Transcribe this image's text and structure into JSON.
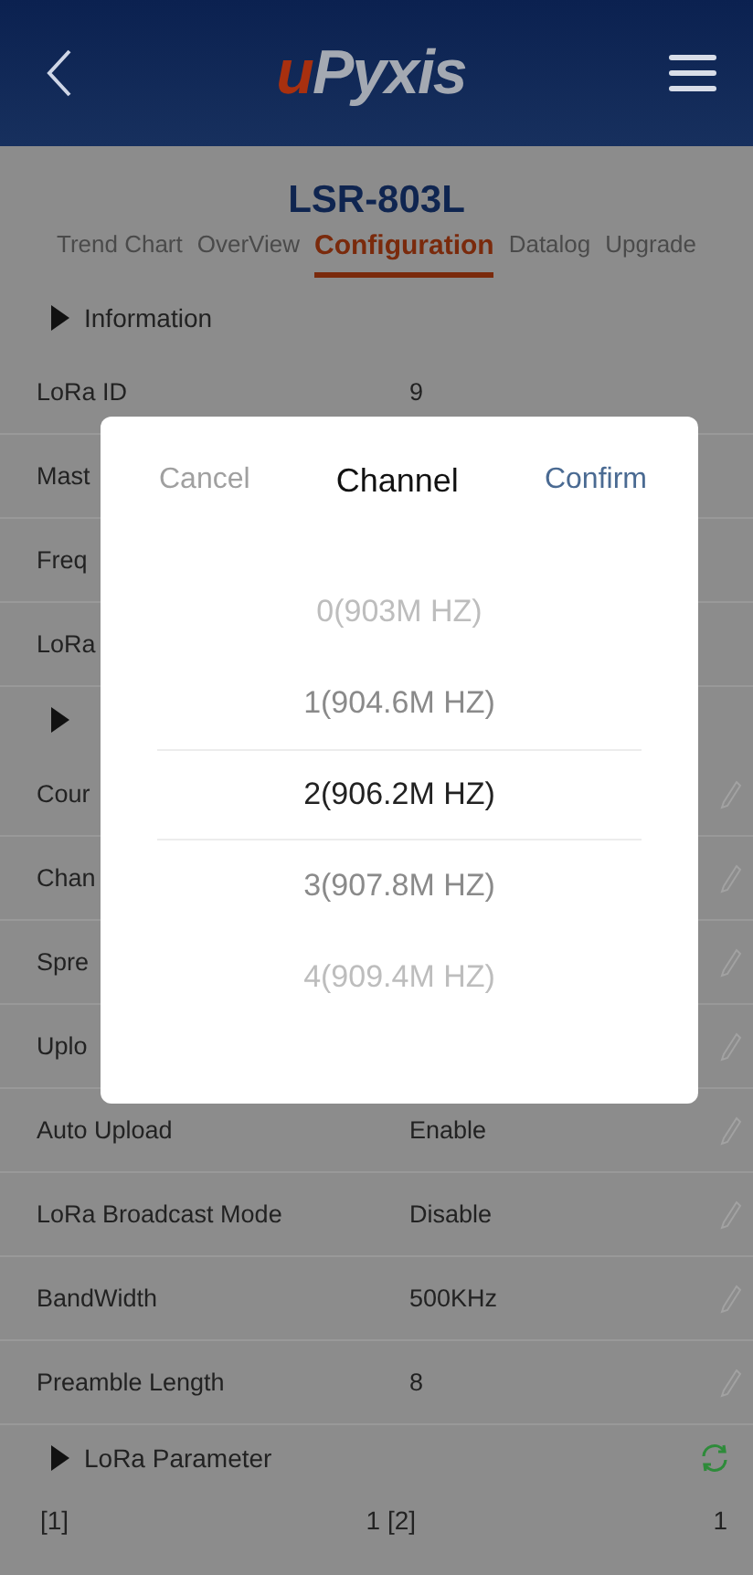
{
  "header": {
    "logo_mark": "u",
    "logo_text": "Pyxis"
  },
  "device_title": "LSR-803L",
  "tabs": [
    {
      "label": "Trend Chart",
      "selected": false
    },
    {
      "label": "OverView",
      "selected": false
    },
    {
      "label": "Configuration",
      "selected": true
    },
    {
      "label": "Datalog",
      "selected": false
    },
    {
      "label": "Upgrade",
      "selected": false
    }
  ],
  "sections": [
    {
      "title": "Information",
      "rows": [
        {
          "label": "LoRa ID",
          "value": "9"
        },
        {
          "label": "Mast"
        },
        {
          "label": "Freq"
        },
        {
          "label": "LoRa"
        }
      ]
    },
    {
      "rows": [
        {
          "label": "Cour",
          "editable": true
        },
        {
          "label": "Chan",
          "editable": true
        },
        {
          "label": "Spre",
          "editable": true
        },
        {
          "label": "Uplo",
          "editable": true
        },
        {
          "label": "Auto Upload",
          "value": "Enable",
          "editable": true
        },
        {
          "label": "LoRa Broadcast Mode",
          "value": "Disable",
          "editable": true
        },
        {
          "label": "BandWidth",
          "value": "500KHz",
          "editable": true
        },
        {
          "label": "Preamble Length",
          "value": "8",
          "editable": true
        }
      ]
    },
    {
      "title": "LoRa Parameter",
      "refresh": true
    }
  ],
  "parameters": [
    {
      "label": "[1]",
      "value": "1"
    },
    {
      "label": "[2]",
      "value": "1"
    }
  ],
  "dialog": {
    "cancel": "Cancel",
    "title": "Channel",
    "confirm": "Confirm",
    "options": [
      {
        "label": "0(903M HZ)",
        "selected": false
      },
      {
        "label": "1(904.6M HZ)",
        "selected": false
      },
      {
        "label": "2(906.2M HZ)",
        "selected": true
      },
      {
        "label": "3(907.8M HZ)",
        "selected": false
      },
      {
        "label": "4(909.4M HZ)",
        "selected": false
      }
    ]
  }
}
